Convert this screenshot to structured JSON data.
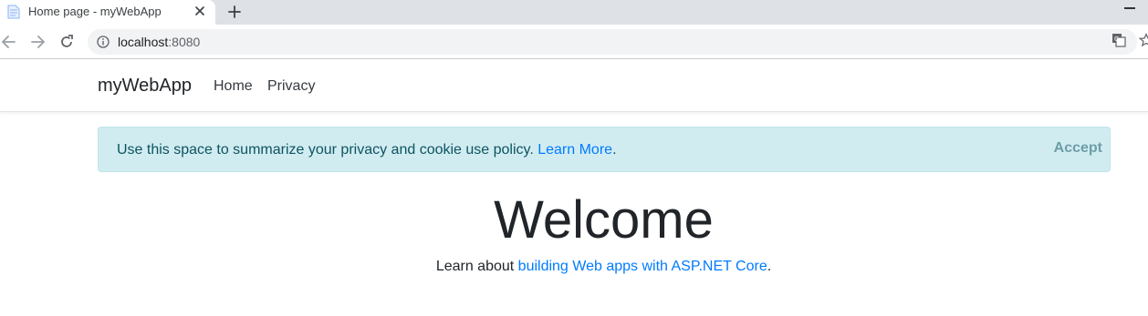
{
  "browser": {
    "tab": {
      "title": "Home page - myWebApp",
      "favicon": "page-icon"
    },
    "address": {
      "host": "localhost",
      "port": ":8080"
    }
  },
  "navbar": {
    "brand": "myWebApp",
    "links": [
      "Home",
      "Privacy"
    ]
  },
  "cookie": {
    "text": "Use this space to summarize your privacy and cookie use policy. ",
    "link": "Learn More",
    "after_link": ".",
    "accept": "Accept"
  },
  "main": {
    "heading": "Welcome",
    "learn_prefix": "Learn about ",
    "learn_link": "building Web apps with ASP.NET Core",
    "learn_suffix": "."
  },
  "colors": {
    "link": "#007bff",
    "alert_bg": "#d1ecf1",
    "alert_text": "#0c5460",
    "tabstrip": "#dee1e6"
  }
}
